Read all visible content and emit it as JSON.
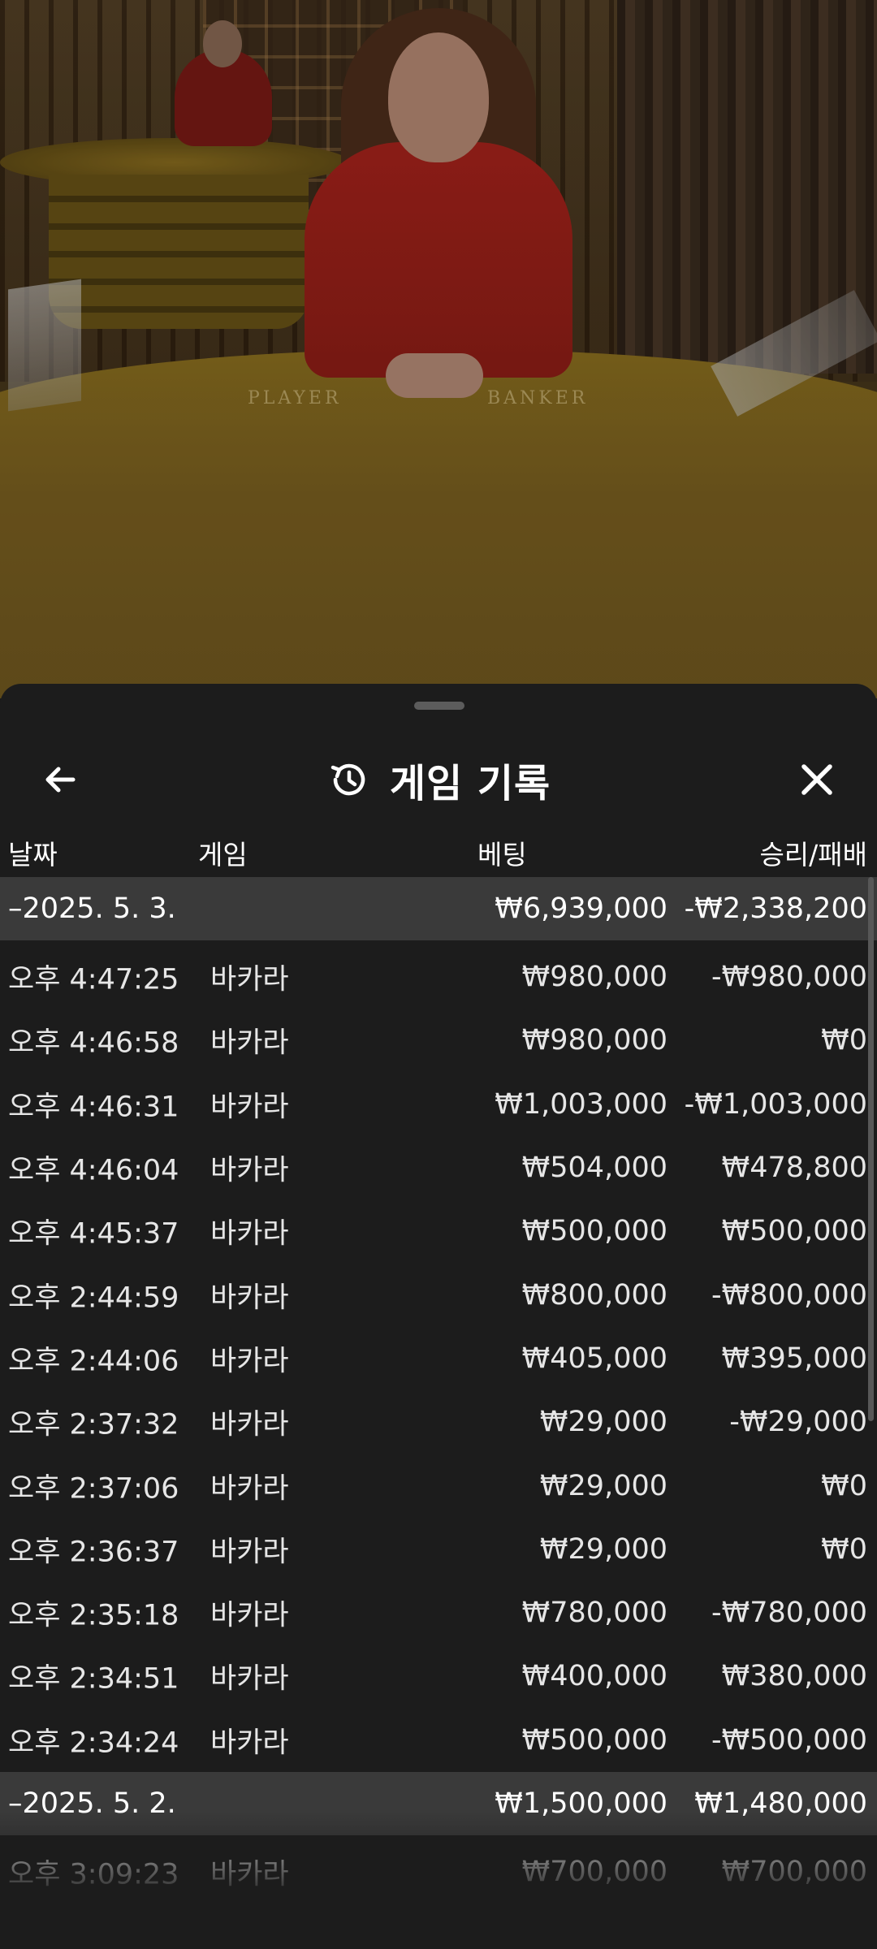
{
  "header": {
    "title": "게임 기록",
    "back_icon": "arrow-left-icon",
    "history_icon": "history-clock-icon",
    "close_icon": "close-icon"
  },
  "video": {
    "table_left_label": "PLAYER",
    "table_right_label": "BANKER"
  },
  "columns": {
    "date": "날짜",
    "game": "게임",
    "bet": "베팅",
    "result": "승리/패배"
  },
  "groups": [
    {
      "date": "–2025. 5. 3.",
      "bet_total": "₩6,939,000",
      "result_total": "-₩2,338,200",
      "rows": [
        {
          "time": "오후 4:47:25",
          "game": "바카라",
          "bet": "₩980,000",
          "result": "-₩980,000"
        },
        {
          "time": "오후 4:46:58",
          "game": "바카라",
          "bet": "₩980,000",
          "result": "₩0"
        },
        {
          "time": "오후 4:46:31",
          "game": "바카라",
          "bet": "₩1,003,000",
          "result": "-₩1,003,000"
        },
        {
          "time": "오후 4:46:04",
          "game": "바카라",
          "bet": "₩504,000",
          "result": "₩478,800"
        },
        {
          "time": "오후 4:45:37",
          "game": "바카라",
          "bet": "₩500,000",
          "result": "₩500,000"
        },
        {
          "time": "오후 2:44:59",
          "game": "바카라",
          "bet": "₩800,000",
          "result": "-₩800,000"
        },
        {
          "time": "오후 2:44:06",
          "game": "바카라",
          "bet": "₩405,000",
          "result": "₩395,000"
        },
        {
          "time": "오후 2:37:32",
          "game": "바카라",
          "bet": "₩29,000",
          "result": "-₩29,000"
        },
        {
          "time": "오후 2:37:06",
          "game": "바카라",
          "bet": "₩29,000",
          "result": "₩0"
        },
        {
          "time": "오후 2:36:37",
          "game": "바카라",
          "bet": "₩29,000",
          "result": "₩0"
        },
        {
          "time": "오후 2:35:18",
          "game": "바카라",
          "bet": "₩780,000",
          "result": "-₩780,000"
        },
        {
          "time": "오후 2:34:51",
          "game": "바카라",
          "bet": "₩400,000",
          "result": "₩380,000"
        },
        {
          "time": "오후 2:34:24",
          "game": "바카라",
          "bet": "₩500,000",
          "result": "-₩500,000"
        }
      ]
    },
    {
      "date": "–2025. 5. 2.",
      "bet_total": "₩1,500,000",
      "result_total": "₩1,480,000",
      "rows": [
        {
          "time": "오후 3:09:23",
          "game": "바카라",
          "bet": "₩700,000",
          "result": "₩700,000"
        }
      ]
    }
  ]
}
